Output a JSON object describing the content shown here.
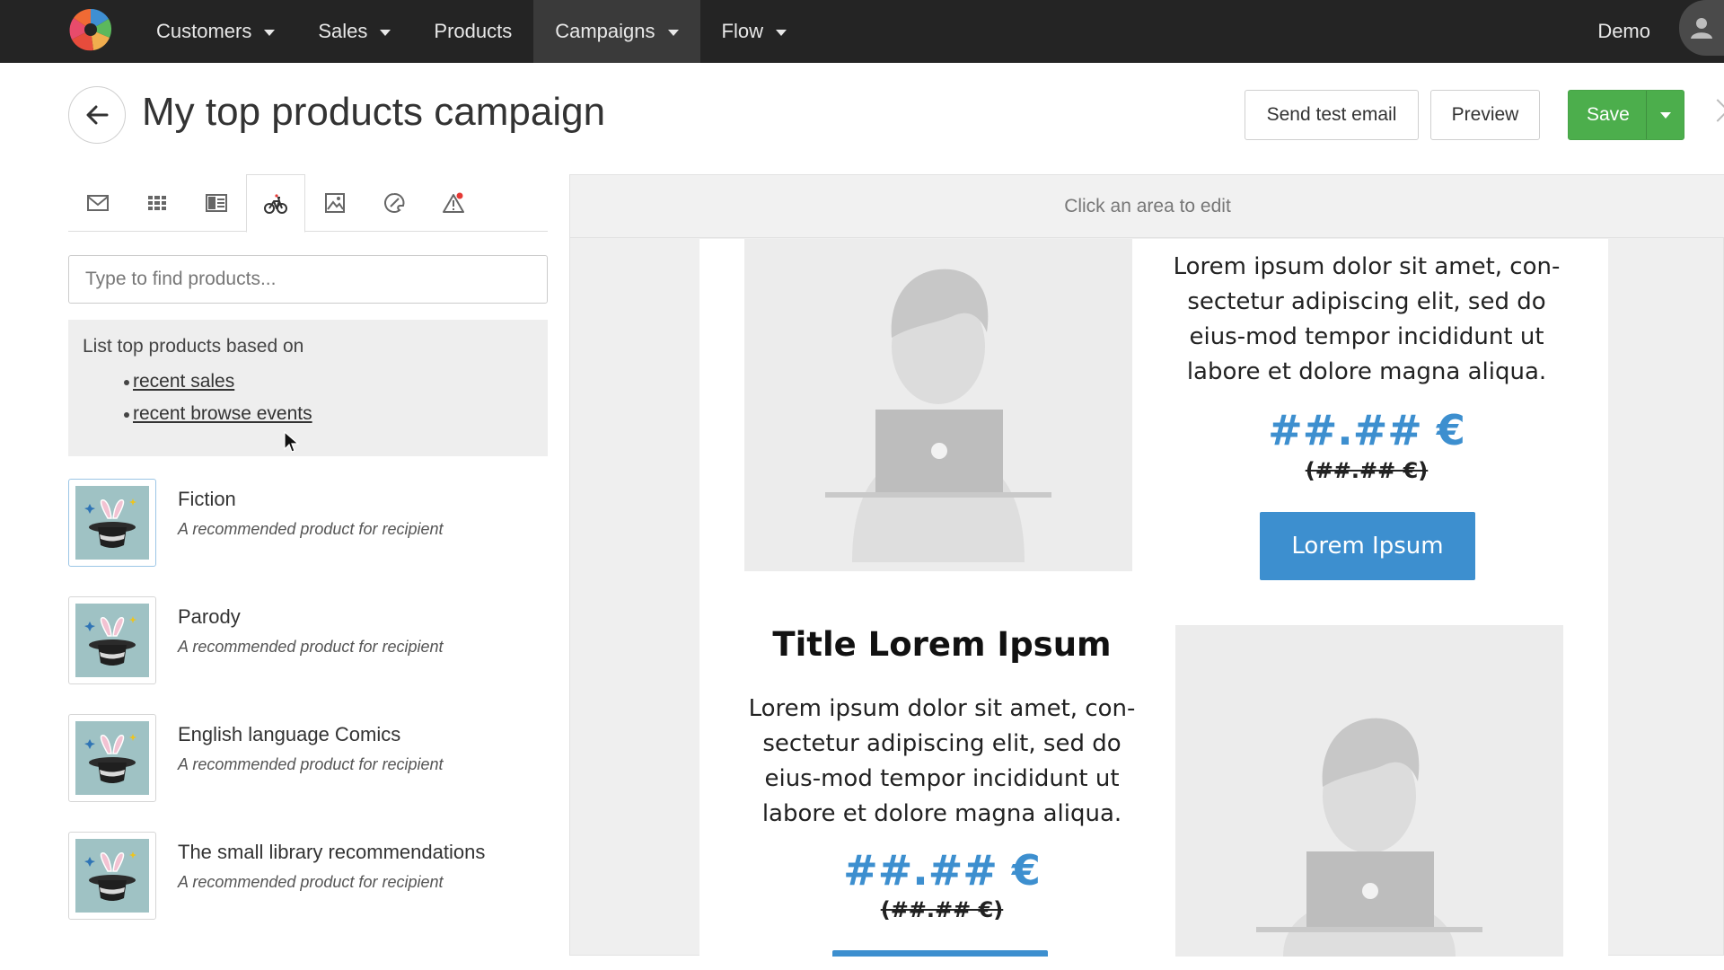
{
  "nav": {
    "items": [
      {
        "label": "Customers",
        "dropdown": true,
        "active": false
      },
      {
        "label": "Sales",
        "dropdown": true,
        "active": false
      },
      {
        "label": "Products",
        "dropdown": false,
        "active": false
      },
      {
        "label": "Campaigns",
        "dropdown": true,
        "active": true
      },
      {
        "label": "Flow",
        "dropdown": true,
        "active": false
      }
    ],
    "user": "Demo"
  },
  "header": {
    "title": "My top products campaign",
    "send_test_label": "Send test email",
    "preview_label": "Preview",
    "save_label": "Save"
  },
  "tabs": [
    {
      "icon": "mail-icon",
      "active": false
    },
    {
      "icon": "grid-icon",
      "active": false
    },
    {
      "icon": "columns-icon",
      "active": false
    },
    {
      "icon": "bicycle-icon",
      "active": true
    },
    {
      "icon": "image-icon",
      "active": false
    },
    {
      "icon": "palette-icon",
      "active": false
    },
    {
      "icon": "warning-icon",
      "active": false
    }
  ],
  "search": {
    "placeholder": "Type to find products...",
    "value": ""
  },
  "info": {
    "lead": "List top products based on",
    "links": [
      "recent sales",
      "recent browse events"
    ]
  },
  "products": [
    {
      "name": "Fiction",
      "desc": "A recommended product for recipient",
      "selected": true
    },
    {
      "name": "Parody",
      "desc": "A recommended product for recipient",
      "selected": false
    },
    {
      "name": "English language Comics",
      "desc": "A recommended product for recipient",
      "selected": false
    },
    {
      "name": "The small library recommendations",
      "desc": "A recommended product for recipient",
      "selected": false
    }
  ],
  "preview": {
    "hint": "Click an area to edit",
    "block1": {
      "text": "Lorem ipsum dolor sit amet, con-sectetur adipiscing elit, sed do eius-mod tempor incididunt ut labore et dolore magna aliqua.",
      "price": "##.## €",
      "old_price": "(##.## €)",
      "button": "Lorem Ipsum"
    },
    "block2": {
      "title": "Title Lorem Ipsum",
      "text": "Lorem ipsum dolor sit amet, con-sectetur adipiscing elit, sed do eius-mod tempor incididunt ut labore et dolore magna aliqua.",
      "price": "##.## €",
      "old_price": "(##.## €)"
    }
  },
  "colors": {
    "nav_bg": "#242424",
    "save_green": "#4cae4c",
    "accent_blue": "#3d8fcf"
  }
}
